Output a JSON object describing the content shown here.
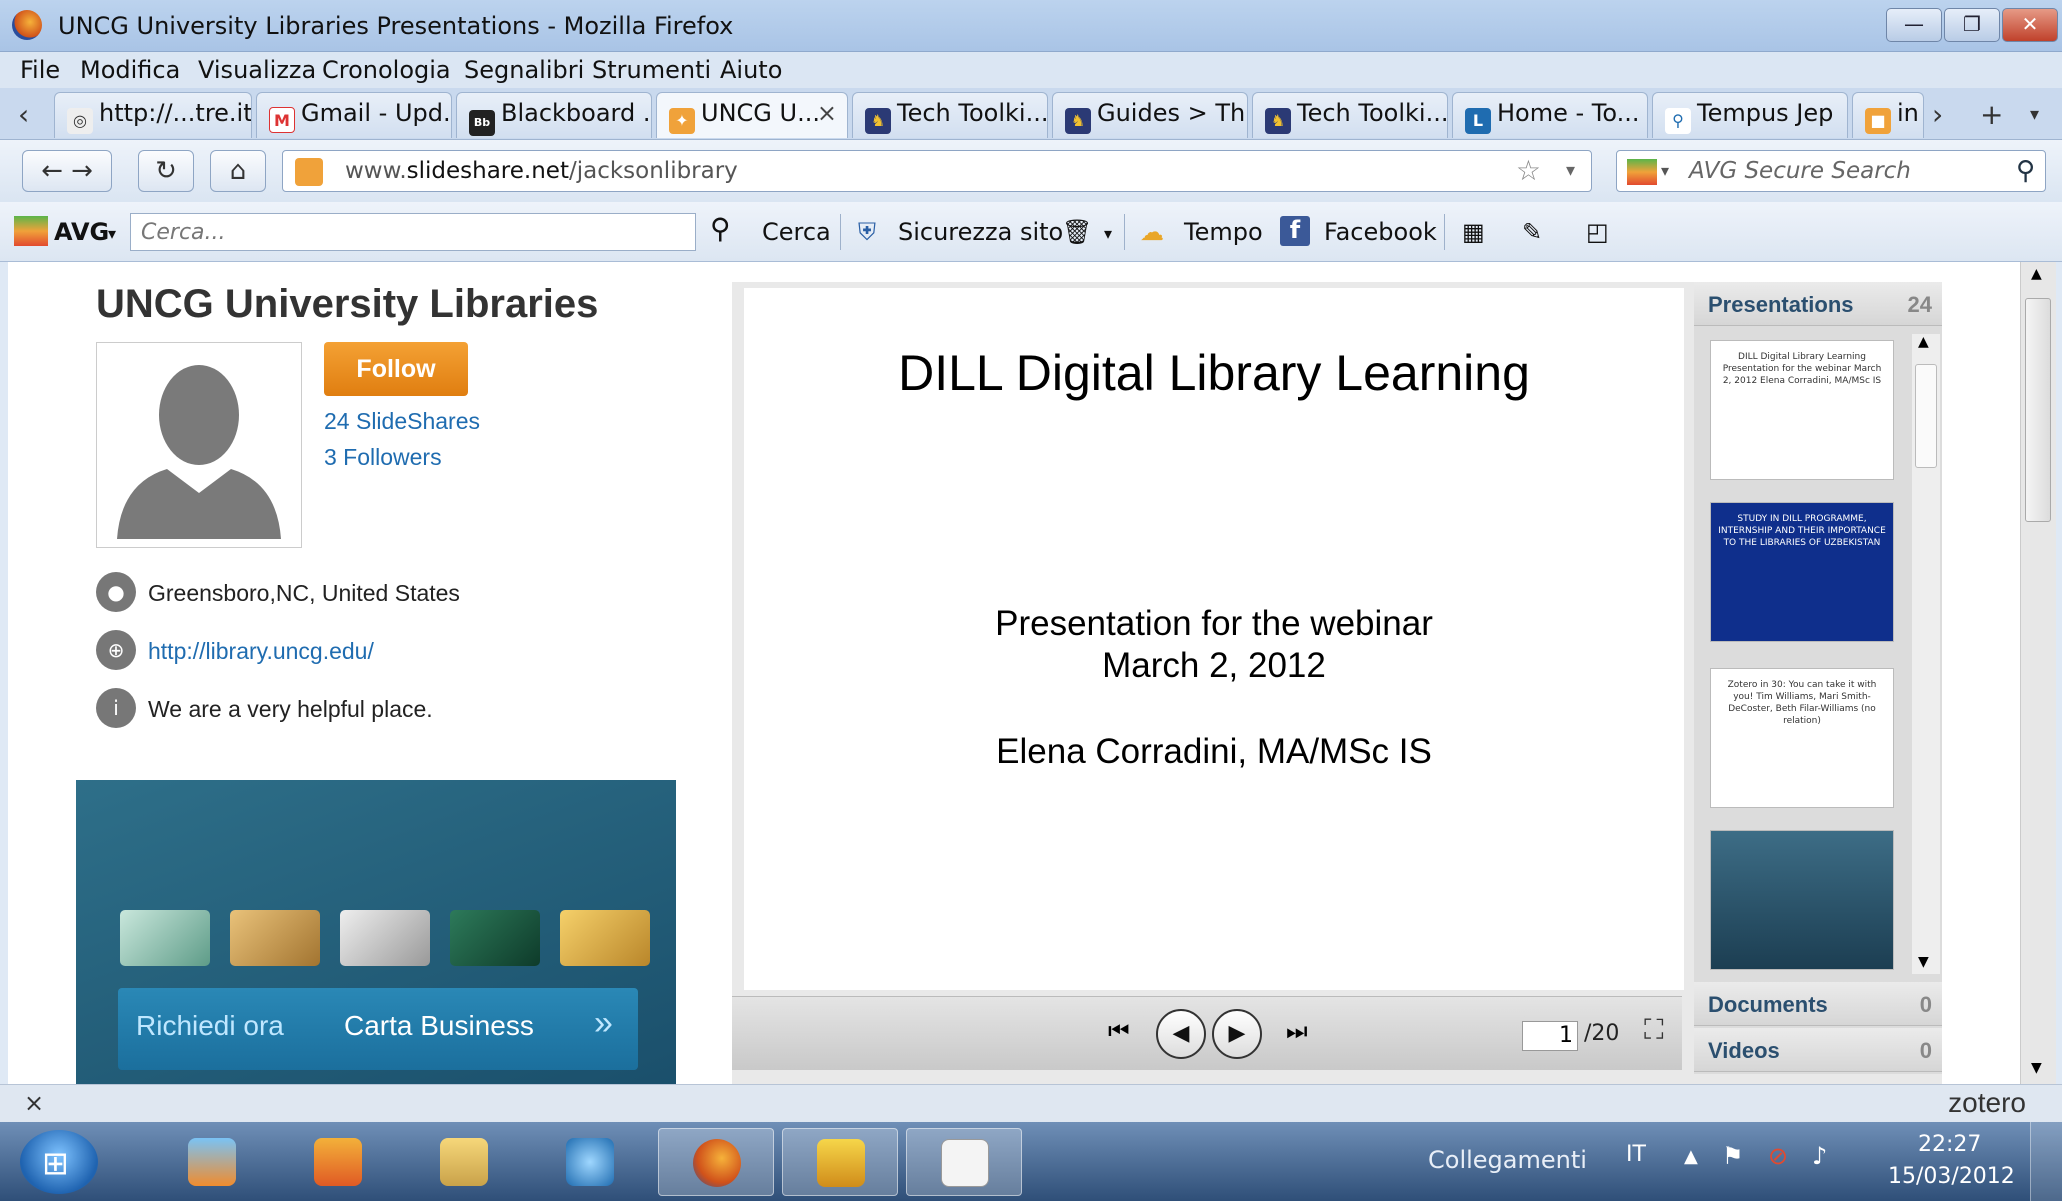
{
  "window": {
    "title": "UNCG University Libraries Presentations - Mozilla Firefox",
    "controls": {
      "minimize": "—",
      "restore": "❐",
      "close": "✕"
    }
  },
  "menu": [
    "File",
    "Modifica",
    "Visualizza",
    "Cronologia",
    "Segnalibri",
    "Strumenti",
    "Aiuto"
  ],
  "tabs": [
    {
      "label": "http://...tre.it/",
      "icon": "globe-icon"
    },
    {
      "label": "Gmail - Upd...",
      "icon": "gmail-icon"
    },
    {
      "label": "Blackboard ...",
      "icon": "blackboard-icon"
    },
    {
      "label": "UNCG U...",
      "icon": "slideshare-icon",
      "active": true
    },
    {
      "label": "Tech Toolki...",
      "icon": "tech-icon"
    },
    {
      "label": "Guides > Th...",
      "icon": "tech-icon"
    },
    {
      "label": "Tech Toolki...",
      "icon": "tech-icon"
    },
    {
      "label": "Home - To...",
      "icon": "home-icon"
    },
    {
      "label": "Tempus Jep",
      "icon": "search-icon"
    },
    {
      "label": "in",
      "icon": "avg-icon"
    }
  ],
  "nav": {
    "url_prefix": "www.",
    "url_domain": "slideshare.net",
    "url_path": "/jacksonlibrary",
    "search_placeholder": "AVG Secure Search"
  },
  "avg": {
    "brand": "AVG",
    "search_placeholder": "Cerca...",
    "cerca": "Cerca",
    "sicurezza": "Sicurezza sito",
    "tempo": "Tempo",
    "facebook": "Facebook"
  },
  "profile": {
    "title": "UNCG University Libraries",
    "follow": "Follow",
    "slideshares": "24 SlideShares",
    "followers": "3 Followers",
    "location": "Greensboro,NC, United States",
    "website": "http://library.uncg.edu/",
    "about": "We are a very helpful place."
  },
  "ad": {
    "cta_left": "Richiedi ora",
    "cta_right": "Carta Business",
    "arrow": "»"
  },
  "slide": {
    "title": "DILL Digital Library Learning",
    "line1": "Presentation for the webinar",
    "line2": "March 2, 2012",
    "line3": "Elena Corradini, MA/MSc IS",
    "page": "1",
    "total": "/20"
  },
  "side": {
    "presentations": "Presentations",
    "presentations_count": "24",
    "documents": "Documents",
    "documents_count": "0",
    "videos": "Videos",
    "videos_count": "0",
    "thumbs": [
      {
        "text": "DILL Digital Library Learning  Presentation for the webinar March 2, 2012  Elena Corradini, MA/MSc IS"
      },
      {
        "text": "STUDY IN DILL PROGRAMME, INTERNSHIP AND THEIR IMPORTANCE TO THE LIBRARIES OF UZBEKISTAN"
      },
      {
        "text": "Zotero in 30: You can take it with you!  Tim Williams, Mari Smith-DeCoster, Beth Filar-Williams (no relation)"
      },
      {
        "text": ""
      }
    ]
  },
  "zotero": "zotero",
  "taskbar": {
    "links": "Collegamenti",
    "lang": "IT",
    "time": "22:27",
    "date": "15/03/2012"
  }
}
